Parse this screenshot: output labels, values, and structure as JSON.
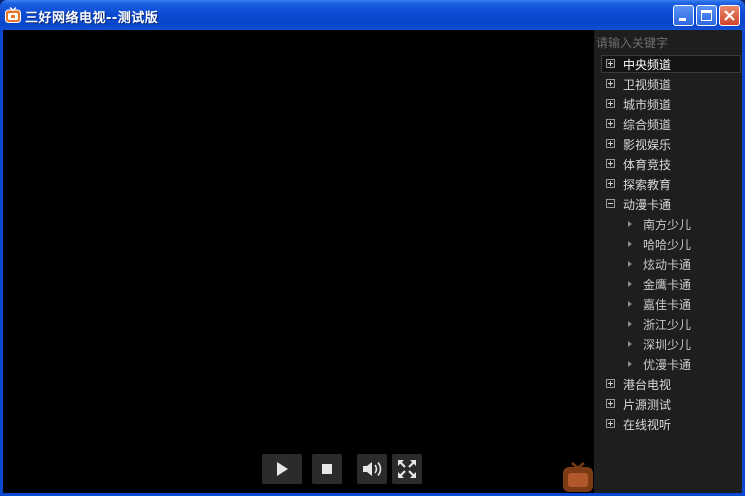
{
  "window": {
    "title": "三好网络电视--测试版"
  },
  "colors": {
    "titlebar": "#0b4bd4",
    "panel_bg": "#1e1e1e",
    "video_bg": "#000000",
    "accent_icon": "#e8742a"
  },
  "title_buttons": [
    "minimize-icon",
    "maximize-icon",
    "close-icon"
  ],
  "controls": [
    "play-icon",
    "stop-icon",
    "volume-icon",
    "fullscreen-icon"
  ],
  "search": {
    "placeholder": "请输入关键字"
  },
  "tree": [
    {
      "label": "中央频道",
      "expanded": false,
      "selected": true
    },
    {
      "label": "卫视频道",
      "expanded": false
    },
    {
      "label": "城市频道",
      "expanded": false
    },
    {
      "label": "综合频道",
      "expanded": false
    },
    {
      "label": "影视娱乐",
      "expanded": false
    },
    {
      "label": "体育竞技",
      "expanded": false
    },
    {
      "label": "探索教育",
      "expanded": false
    },
    {
      "label": "动漫卡通",
      "expanded": true,
      "children": [
        "南方少儿",
        "哈哈少儿",
        "炫动卡通",
        "金鹰卡通",
        "嘉佳卡通",
        "浙江少儿",
        "深圳少儿",
        "优漫卡通"
      ]
    },
    {
      "label": "港台电视",
      "expanded": false
    },
    {
      "label": "片源测试",
      "expanded": false
    },
    {
      "label": "在线视听",
      "expanded": false
    }
  ]
}
